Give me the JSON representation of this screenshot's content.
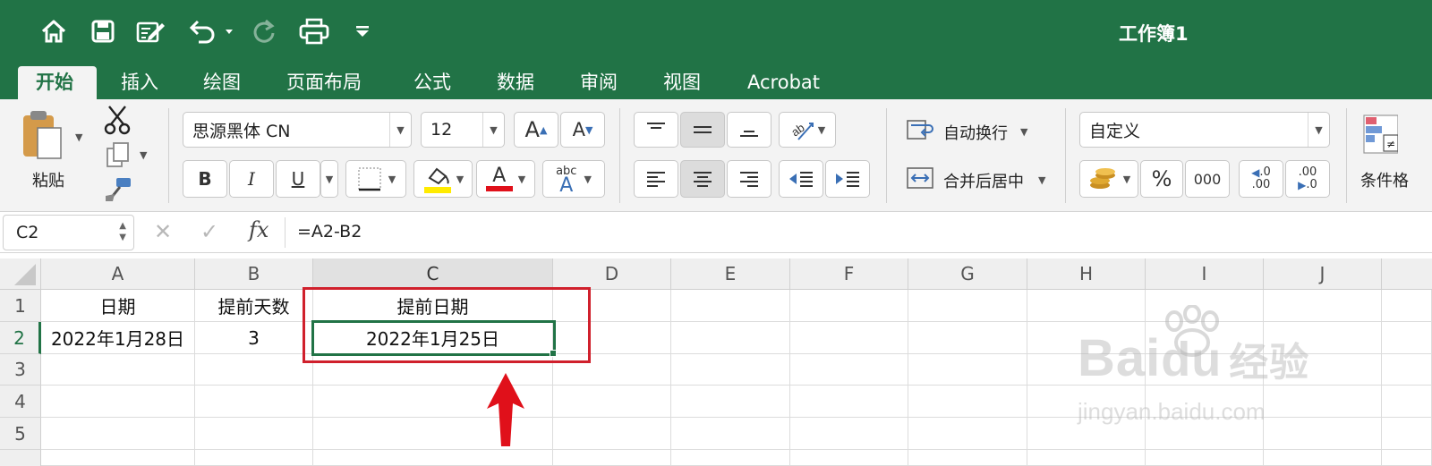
{
  "window": {
    "title": "工作簿1"
  },
  "quick_access": [
    {
      "name": "home-icon"
    },
    {
      "name": "save-icon"
    },
    {
      "name": "edit-icon"
    },
    {
      "name": "undo-icon"
    },
    {
      "name": "redo-icon"
    },
    {
      "name": "print-icon"
    },
    {
      "name": "customize-icon"
    }
  ],
  "tabs": [
    {
      "label": "开始",
      "active": true
    },
    {
      "label": "插入"
    },
    {
      "label": "绘图"
    },
    {
      "label": "页面布局"
    },
    {
      "label": "公式"
    },
    {
      "label": "数据"
    },
    {
      "label": "审阅"
    },
    {
      "label": "视图"
    },
    {
      "label": "Acrobat"
    }
  ],
  "ribbon": {
    "paste_label": "粘贴",
    "font_name": "思源黑体 CN",
    "font_size": "12",
    "bold": "B",
    "italic": "I",
    "underline": "U",
    "font_color_glyph": "A",
    "phonetic_small": "abc",
    "phonetic_big": "A",
    "grow_font": "A",
    "shrink_font": "A",
    "wrap_text": "自动换行",
    "merge_center": "合并后居中",
    "number_format": "自定义",
    "percent": "%",
    "comma": "000",
    "inc_decimal": ".0",
    "inc_decimal_2": ".00",
    "dec_decimal": ".00",
    "dec_decimal_2": ".0",
    "conditional_format": "条件格"
  },
  "formula_bar": {
    "name_box": "C2",
    "fx": "fx",
    "formula": "=A2-B2"
  },
  "sheet": {
    "columns": [
      "A",
      "B",
      "C",
      "D",
      "E",
      "F",
      "G",
      "H",
      "I",
      "J"
    ],
    "rows": [
      "1",
      "2",
      "3",
      "4",
      "5"
    ],
    "cells": {
      "A1": "日期",
      "B1": "提前天数",
      "C1": "提前日期",
      "A2": "2022年1月28日",
      "B2": "3",
      "C2": "2022年1月25日"
    },
    "selected_cell": "C2"
  },
  "watermark": {
    "brand": "Bai",
    "brand_2": "du",
    "brand_cn": "经验",
    "url": "jingyan.baidu.com"
  },
  "colors": {
    "excel_green": "#217346",
    "highlight_red": "#d0202c",
    "fill_yellow": "#ffeb00",
    "font_red": "#e0101a"
  }
}
